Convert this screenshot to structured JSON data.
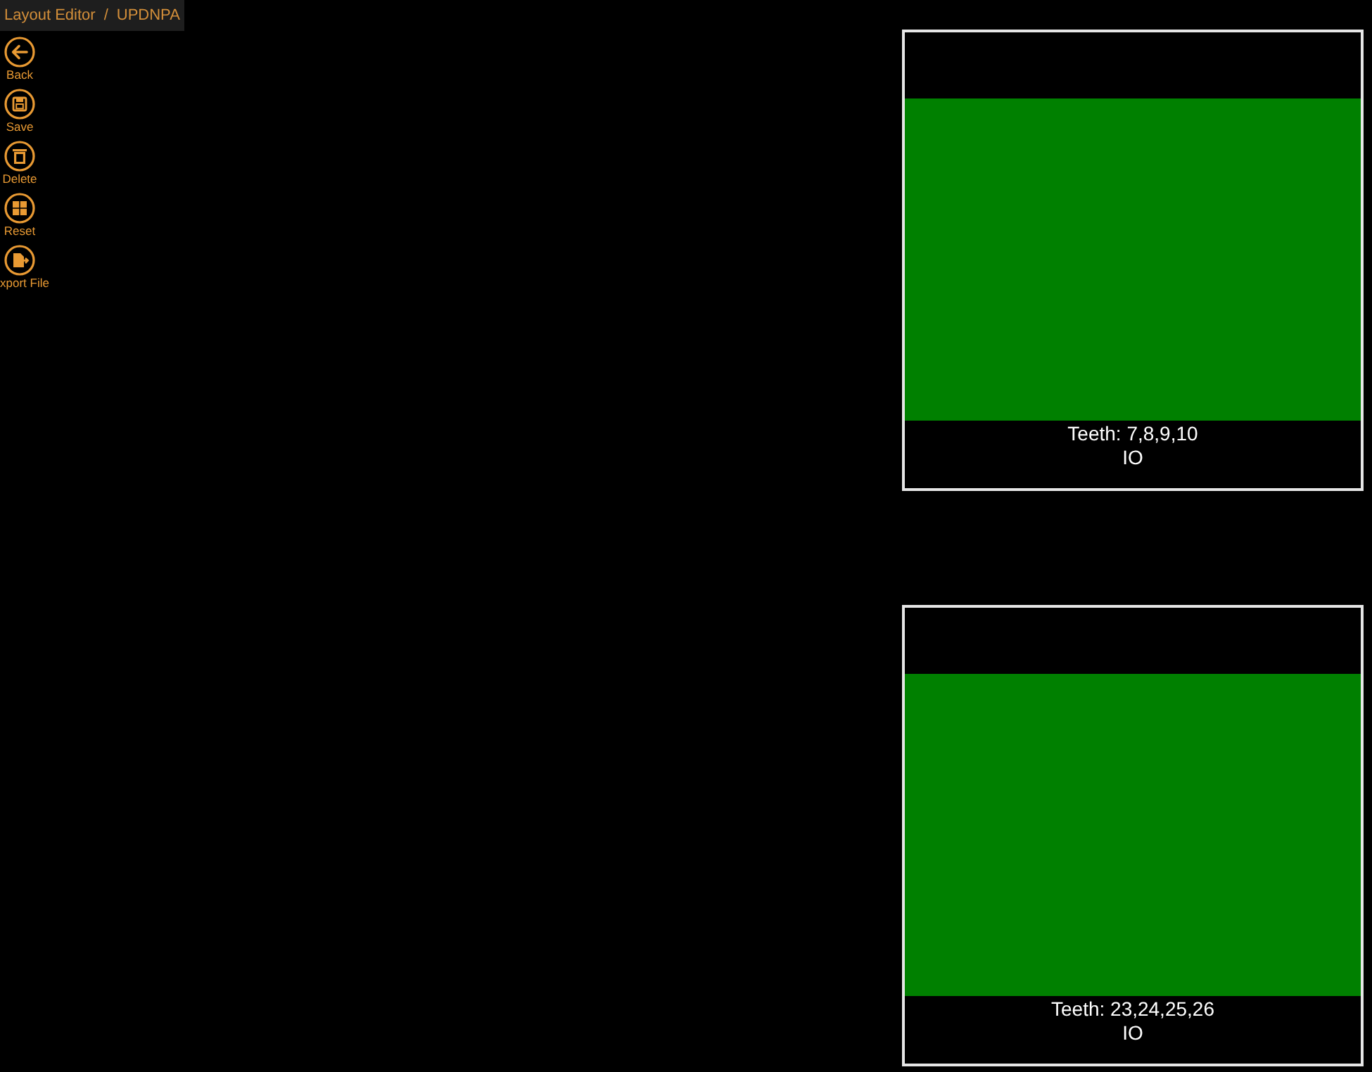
{
  "breadcrumb": {
    "items": [
      "Layout Editor",
      "UPDNPA"
    ],
    "separator": "/"
  },
  "toolbar": [
    {
      "kind": "back",
      "label": "Back"
    },
    {
      "kind": "save",
      "label": "Save"
    },
    {
      "kind": "delete",
      "label": "Delete"
    },
    {
      "kind": "reset",
      "label": "Reset"
    },
    {
      "kind": "export",
      "label": "xport File"
    }
  ],
  "cards": [
    {
      "title": "Teeth: 7,8,9,10",
      "subtitle": "IO"
    },
    {
      "title": "Teeth: 23,24,25,26",
      "subtitle": "IO"
    }
  ]
}
